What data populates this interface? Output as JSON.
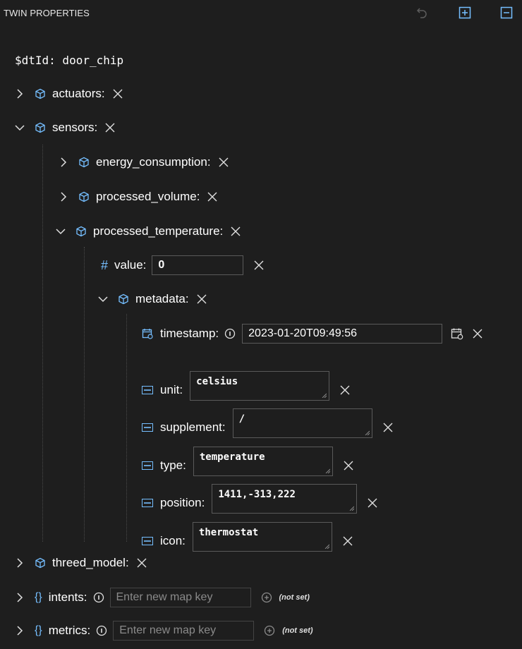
{
  "header": {
    "title": "TWIN PROPERTIES"
  },
  "dtid": {
    "label": "$dtId: door_chip"
  },
  "tree": {
    "actuators": "actuators:",
    "sensors": "sensors:",
    "energy_consumption": "energy_consumption:",
    "processed_volume": "processed_volume:",
    "processed_temperature": "processed_temperature:",
    "value_label": "value:",
    "value": "0",
    "metadata": "metadata:",
    "timestamp_label": "timestamp:",
    "timestamp_value": "2023-01-20T09:49:56",
    "unit_label": "unit:",
    "unit_value": "celsius",
    "supplement_label": "supplement:",
    "supplement_value": "/",
    "type_label": "type:",
    "type_value": "temperature",
    "position_label": "position:",
    "position_value": "1411,-313,222",
    "icon_label": "icon:",
    "icon_value": "thermostat",
    "threed_model": "threed_model:",
    "intents": "intents:",
    "intents_placeholder": "Enter new map key",
    "intents_status": "(not set)",
    "metrics": "metrics:",
    "metrics_placeholder": "Enter new map key",
    "metrics_status": "(not set)"
  },
  "icons": {
    "undo": "undo-icon",
    "expand_all": "expand-all-icon",
    "collapse_all": "collapse-all-icon",
    "chevron_right": "chevron-right-icon",
    "chevron_down": "chevron-down-icon",
    "component": "cube-icon",
    "delete": "close-icon",
    "number": "hash-icon",
    "string": "string-icon",
    "datetime": "calendar-icon",
    "info": "info-icon",
    "map": "braces-icon",
    "add": "add-circle-icon"
  },
  "colors": {
    "background": "#1e1e1e",
    "accent": "#75beff",
    "border": "#5a5a5a"
  }
}
